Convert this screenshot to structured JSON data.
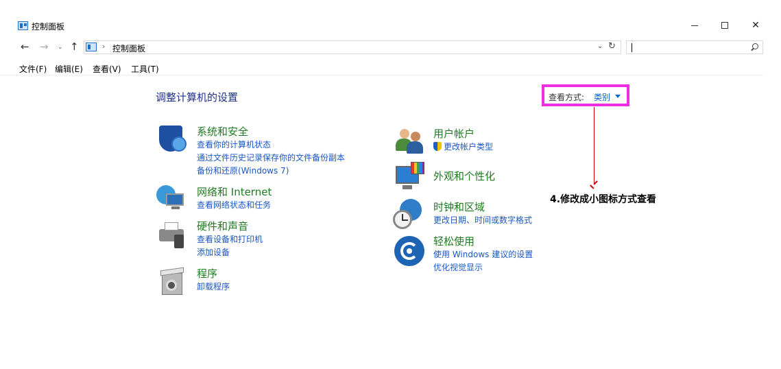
{
  "window": {
    "title": "控制面板",
    "controls": {
      "minimize": "—",
      "maximize": "☐",
      "close": "✕"
    }
  },
  "nav": {
    "back": "←",
    "forward": "→",
    "recent": "⌄",
    "up": "↑",
    "breadcrumb_sep": "›",
    "address": "控制面板",
    "dropdown": "⌄",
    "refresh": "↻",
    "search_value": ""
  },
  "menu": {
    "file": "文件(F)",
    "edit": "编辑(E)",
    "view": "查看(V)",
    "tools": "工具(T)"
  },
  "main": {
    "heading": "调整计算机的设置",
    "view_by_label": "查看方式:",
    "view_by_value": "类别",
    "annotation": "4.修改成小图标方式查看",
    "categories_left": [
      {
        "title": "系统和安全",
        "icon": "shield-icon",
        "links": [
          "查看你的计算机状态",
          "通过文件历史记录保存你的文件备份副本",
          "备份和还原(Windows 7)"
        ]
      },
      {
        "title": "网络和 Internet",
        "icon": "network-icon",
        "links": [
          "查看网络状态和任务"
        ]
      },
      {
        "title": "硬件和声音",
        "icon": "printer-icon",
        "links": [
          "查看设备和打印机",
          "添加设备"
        ]
      },
      {
        "title": "程序",
        "icon": "programs-icon",
        "links": [
          "卸载程序"
        ]
      }
    ],
    "categories_right": [
      {
        "title": "用户帐户",
        "icon": "users-icon",
        "links": [
          "更改帐户类型"
        ]
      },
      {
        "title": "外观和个性化",
        "icon": "appearance-icon",
        "links": []
      },
      {
        "title": "时钟和区域",
        "icon": "clock-icon",
        "links": [
          "更改日期、时间或数字格式"
        ]
      },
      {
        "title": "轻松使用",
        "icon": "ease-of-access-icon",
        "links": [
          "使用 Windows 建议的设置",
          "优化视觉显示"
        ]
      }
    ]
  },
  "colors": {
    "heading": "#1e3287",
    "category_title": "#1e7a1e",
    "link": "#1a56c4",
    "highlight_box": "#ee2ee0",
    "arrow": "#cc0000"
  }
}
